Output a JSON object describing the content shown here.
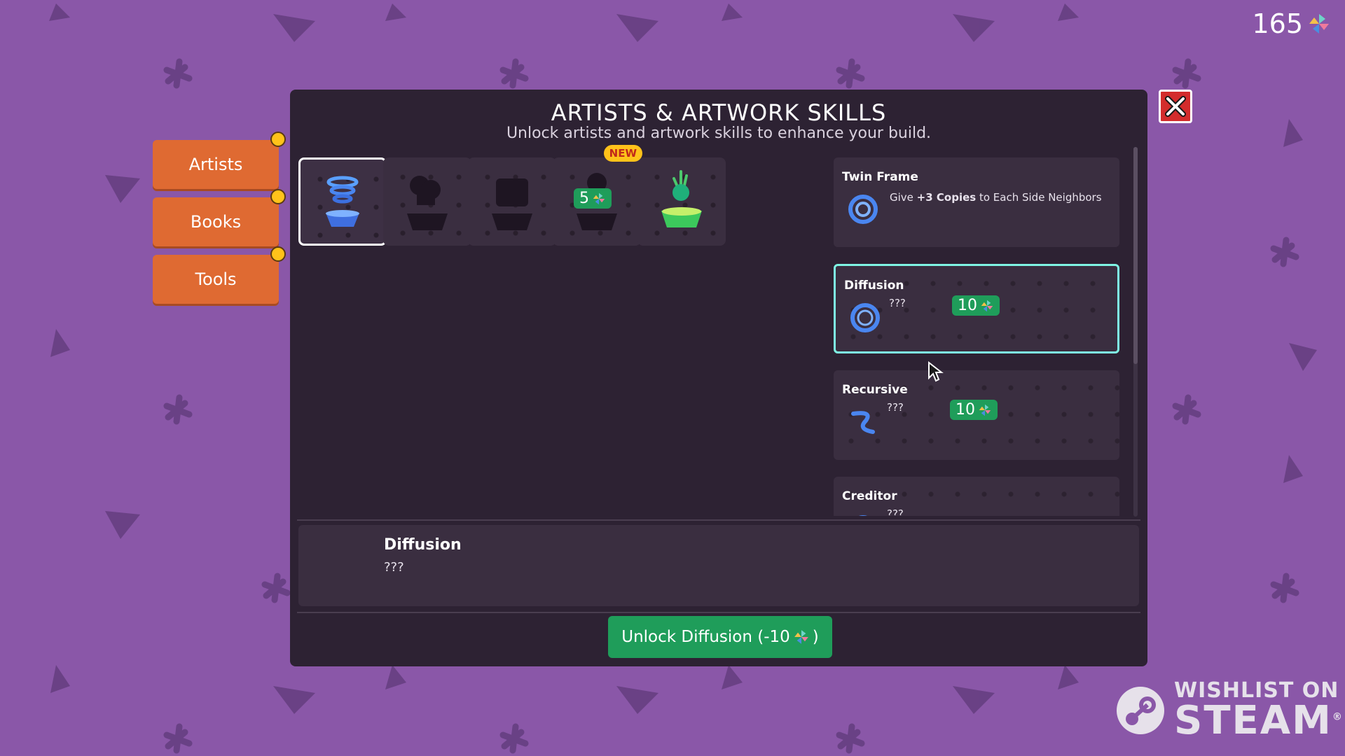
{
  "currency": {
    "amount": "165",
    "icon": "pinwheel-icon"
  },
  "sidebar": {
    "tabs": [
      {
        "label": "Artists",
        "has_notification": true
      },
      {
        "label": "Books",
        "has_notification": true
      },
      {
        "label": "Tools",
        "has_notification": true
      }
    ]
  },
  "panel": {
    "title": "ARTISTS & ARTWORK SKILLS",
    "subtitle": "Unlock artists and artwork skills to enhance your build."
  },
  "artists": [
    {
      "state": "unlocked",
      "selected": true,
      "icon": "blue-tornado-artist-icon"
    },
    {
      "state": "locked",
      "icon": "artist-silhouette-icon"
    },
    {
      "state": "locked",
      "icon": "artist-silhouette-icon"
    },
    {
      "state": "locked",
      "badge": "NEW",
      "price": "5",
      "icon": "artist-silhouette-icon"
    },
    {
      "state": "unlocked",
      "icon": "green-plant-artist-icon"
    }
  ],
  "skills": [
    {
      "name": "Twin Frame",
      "desc_prefix": "Give ",
      "desc_bold": "+3 Copies",
      "desc_suffix": " to Each Side Neighbors",
      "state": "unlocked",
      "icon": "twin-ring-icon"
    },
    {
      "name": "Diffusion",
      "desc": "???",
      "price": "10",
      "state": "locked",
      "selected": true,
      "icon": "diffusion-ring-icon"
    },
    {
      "name": "Recursive",
      "desc": "???",
      "price": "10",
      "state": "locked",
      "icon": "recursive-swirl-icon"
    },
    {
      "name": "Creditor",
      "desc": "???",
      "state": "locked",
      "icon": "creditor-icon"
    }
  ],
  "detail": {
    "title": "Diffusion",
    "desc": "???"
  },
  "unlock_button": {
    "label": "Unlock Diffusion (-10",
    "close_paren": ")"
  },
  "steam_badge": {
    "line1": "WISHLIST ON",
    "line2": "STEAM",
    "reg": "®"
  },
  "colors": {
    "background": "#8a57a8",
    "panel": "#2d2233",
    "accent_green": "#1f9d5a",
    "tab_orange": "#df6a32",
    "selected_outline": "#7ff5e4",
    "notification_yellow": "#ffc21a"
  }
}
